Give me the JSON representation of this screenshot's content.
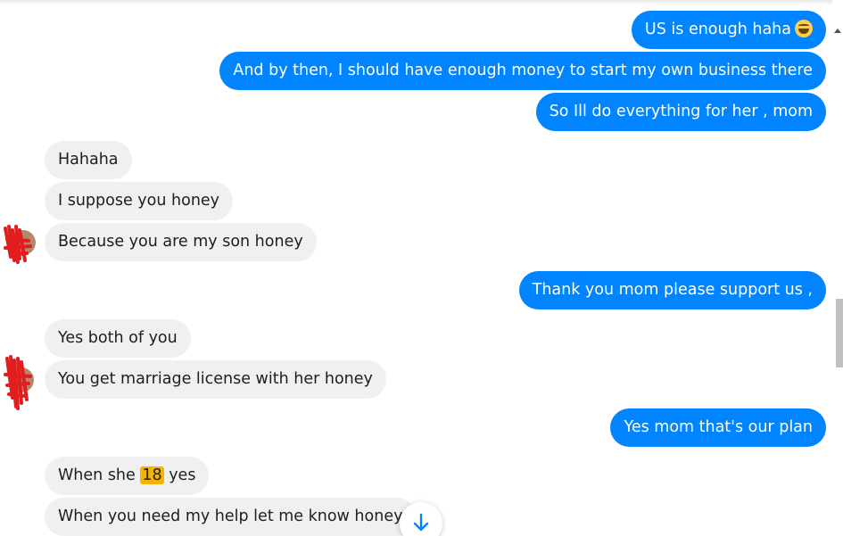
{
  "messages": [
    {
      "direction": "outgoing",
      "text": "US is enough haha",
      "emoji": "grinning-squinting-face"
    },
    {
      "direction": "outgoing",
      "text": "And by then, I should have enough money to start my own business there"
    },
    {
      "direction": "outgoing",
      "text": "So Ill do everything for her , mom"
    },
    {
      "direction": "incoming",
      "text": "Hahaha"
    },
    {
      "direction": "incoming",
      "text": "I suppose you honey"
    },
    {
      "direction": "incoming",
      "text": "Because you are my son honey"
    },
    {
      "direction": "outgoing",
      "text": "Thank you mom please support us ,"
    },
    {
      "direction": "incoming",
      "text": "Yes both of you"
    },
    {
      "direction": "incoming",
      "text": "You get marriage license with her honey"
    },
    {
      "direction": "outgoing",
      "text": "Yes mom that's our plan"
    },
    {
      "direction": "incoming",
      "text_before": "When she ",
      "highlight": "18",
      "text_after": " yes"
    },
    {
      "direction": "incoming",
      "text": "When you need my help let me know honey"
    }
  ],
  "colors": {
    "outgoing_bubble": "#0084ff",
    "incoming_bubble": "#f0f0f0",
    "highlight": "#f4b400",
    "avatar_scribble": "#e11d1d"
  },
  "icons": {
    "jump_to_bottom": "arrow-down-icon",
    "avatar": "redacted-avatar-icon"
  }
}
